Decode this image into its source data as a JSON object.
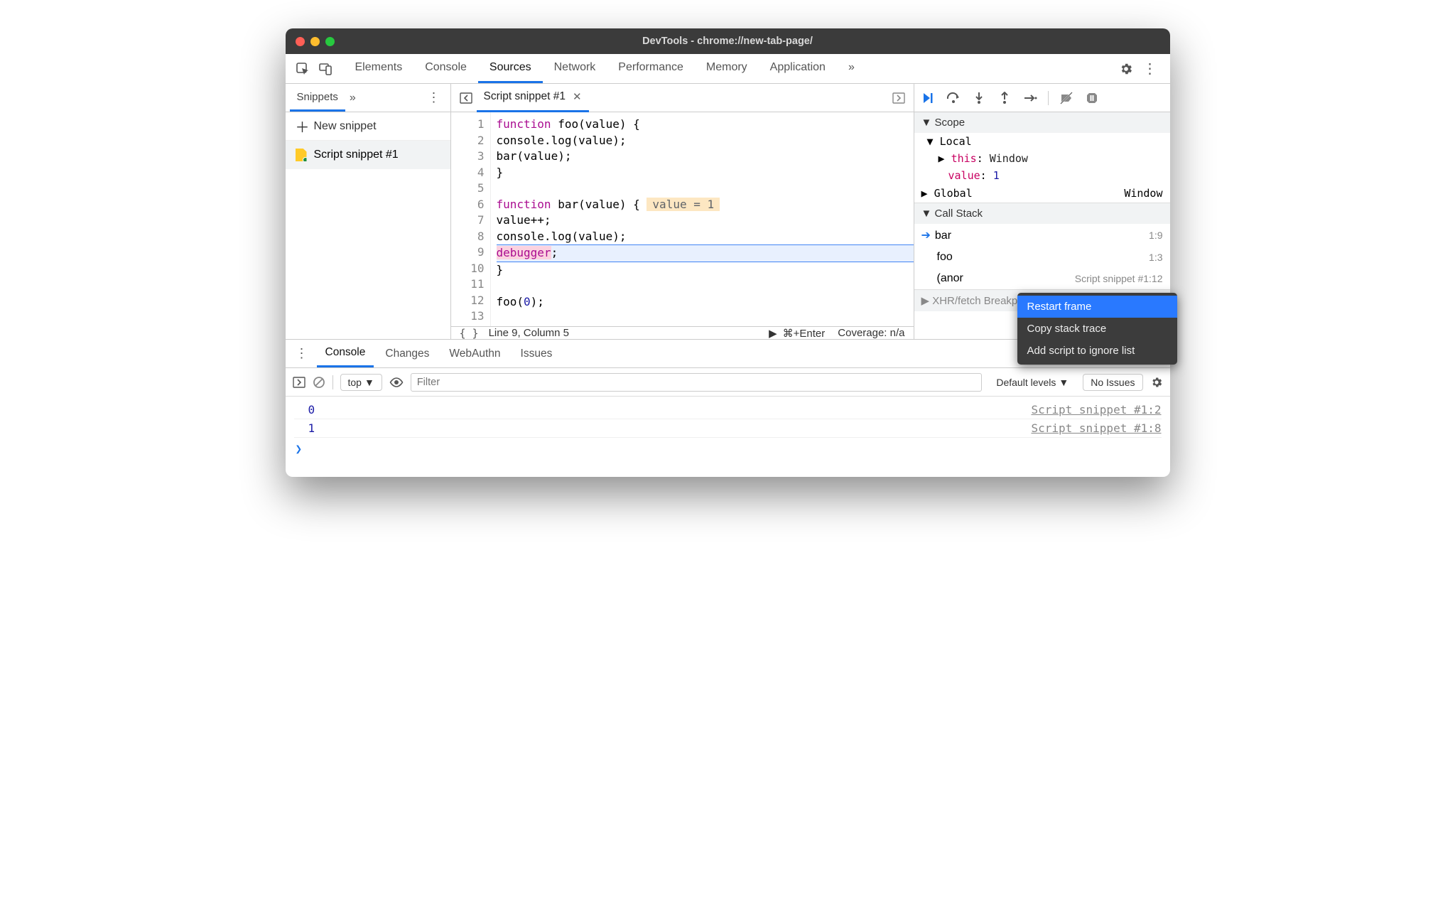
{
  "window": {
    "title": "DevTools - chrome://new-tab-page/"
  },
  "main_tabs": {
    "elements": "Elements",
    "console": "Console",
    "sources": "Sources",
    "network": "Network",
    "performance": "Performance",
    "memory": "Memory",
    "application": "Application",
    "overflow": "»"
  },
  "sidebar": {
    "tab_label": "Snippets",
    "overflow": "»",
    "new_snippet": "New snippet",
    "snippet_name": "Script snippet #1"
  },
  "editor": {
    "tab_label": "Script snippet #1",
    "lines": [
      {
        "n": "1",
        "html": "<span class='kw'>function</span> foo(value) {"
      },
      {
        "n": "2",
        "html": "    console.log(value);"
      },
      {
        "n": "3",
        "html": "    bar(value);"
      },
      {
        "n": "4",
        "html": "}"
      },
      {
        "n": "5",
        "html": ""
      },
      {
        "n": "6",
        "html": "<span class='kw'>function</span> bar(value) {   <span class='inline-hint'>value = 1</span>"
      },
      {
        "n": "7",
        "html": "    value++;"
      },
      {
        "n": "8",
        "html": "    console.log(value);"
      },
      {
        "n": "9",
        "html": "    <span class='dbg'>debugger</span>;"
      },
      {
        "n": "10",
        "html": "}"
      },
      {
        "n": "11",
        "html": ""
      },
      {
        "n": "12",
        "html": "foo(<span style='color:#1a1aa6'>0</span>);"
      },
      {
        "n": "13",
        "html": ""
      }
    ],
    "status_line_col": "Line 9, Column 5",
    "run_hint": "⌘+Enter",
    "coverage": "Coverage: n/a"
  },
  "debug": {
    "scope_header": "Scope",
    "local_label": "Local",
    "this_label": "this",
    "this_value": "Window",
    "value_label": "value",
    "value_value": "1",
    "global_label": "Global",
    "global_value": "Window",
    "callstack_header": "Call Stack",
    "frames": [
      {
        "fn": "bar",
        "loc": "1:9",
        "current": true
      },
      {
        "fn": "foo",
        "loc": "1:3",
        "current": false
      },
      {
        "fn": "(anor",
        "loc": "Script snippet #1:12",
        "current": false
      }
    ],
    "xhr_header": "XHR/fetch Breakpoints"
  },
  "context_menu": {
    "restart": "Restart frame",
    "copy": "Copy stack trace",
    "ignore": "Add script to ignore list"
  },
  "drawer": {
    "tabs": {
      "console": "Console",
      "changes": "Changes",
      "webauthn": "WebAuthn",
      "issues": "Issues"
    },
    "top_context": "top",
    "filter_placeholder": "Filter",
    "levels": "Default levels",
    "no_issues": "No Issues",
    "logs": [
      {
        "value": "0",
        "src": "Script snippet #1:2"
      },
      {
        "value": "1",
        "src": "Script snippet #1:8"
      }
    ]
  }
}
